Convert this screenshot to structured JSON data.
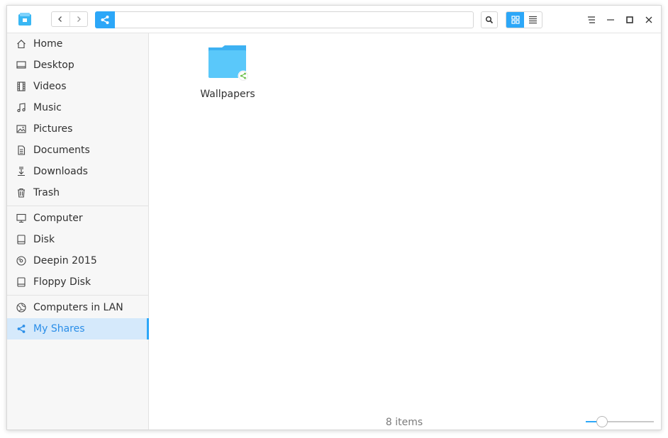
{
  "colors": {
    "accent": "#2ca7f8",
    "active_bg": "#d5e9fb",
    "active_text": "#2b8ee8",
    "folder": "#5ac8fa",
    "share_badge": "#6cc04a"
  },
  "titlebar": {
    "icons": [
      "file-manager-icon",
      "back-icon",
      "forward-icon",
      "share-icon",
      "search-icon",
      "icon-view-icon",
      "list-view-icon",
      "menu-icon",
      "minimize-icon",
      "maximize-icon",
      "close-icon"
    ]
  },
  "sidebar": {
    "group1": [
      {
        "label": "Home",
        "icon": "home-icon"
      },
      {
        "label": "Desktop",
        "icon": "desktop-icon"
      },
      {
        "label": "Videos",
        "icon": "videos-icon"
      },
      {
        "label": "Music",
        "icon": "music-icon"
      },
      {
        "label": "Pictures",
        "icon": "pictures-icon"
      },
      {
        "label": "Documents",
        "icon": "documents-icon"
      },
      {
        "label": "Downloads",
        "icon": "downloads-icon"
      },
      {
        "label": "Trash",
        "icon": "trash-icon"
      }
    ],
    "group2": [
      {
        "label": "Computer",
        "icon": "computer-icon"
      },
      {
        "label": "Disk",
        "icon": "disk-icon"
      },
      {
        "label": "Deepin 2015",
        "icon": "disc-icon"
      },
      {
        "label": "Floppy Disk",
        "icon": "floppy-icon"
      }
    ],
    "group3": [
      {
        "label": "Computers in LAN",
        "icon": "network-icon"
      },
      {
        "label": "My Shares",
        "icon": "share-icon",
        "active": true
      }
    ]
  },
  "main": {
    "files": [
      {
        "name": "Wallpapers",
        "icon": "shared-folder-icon"
      }
    ],
    "status": "8 items",
    "zoom_level": 0.2
  }
}
